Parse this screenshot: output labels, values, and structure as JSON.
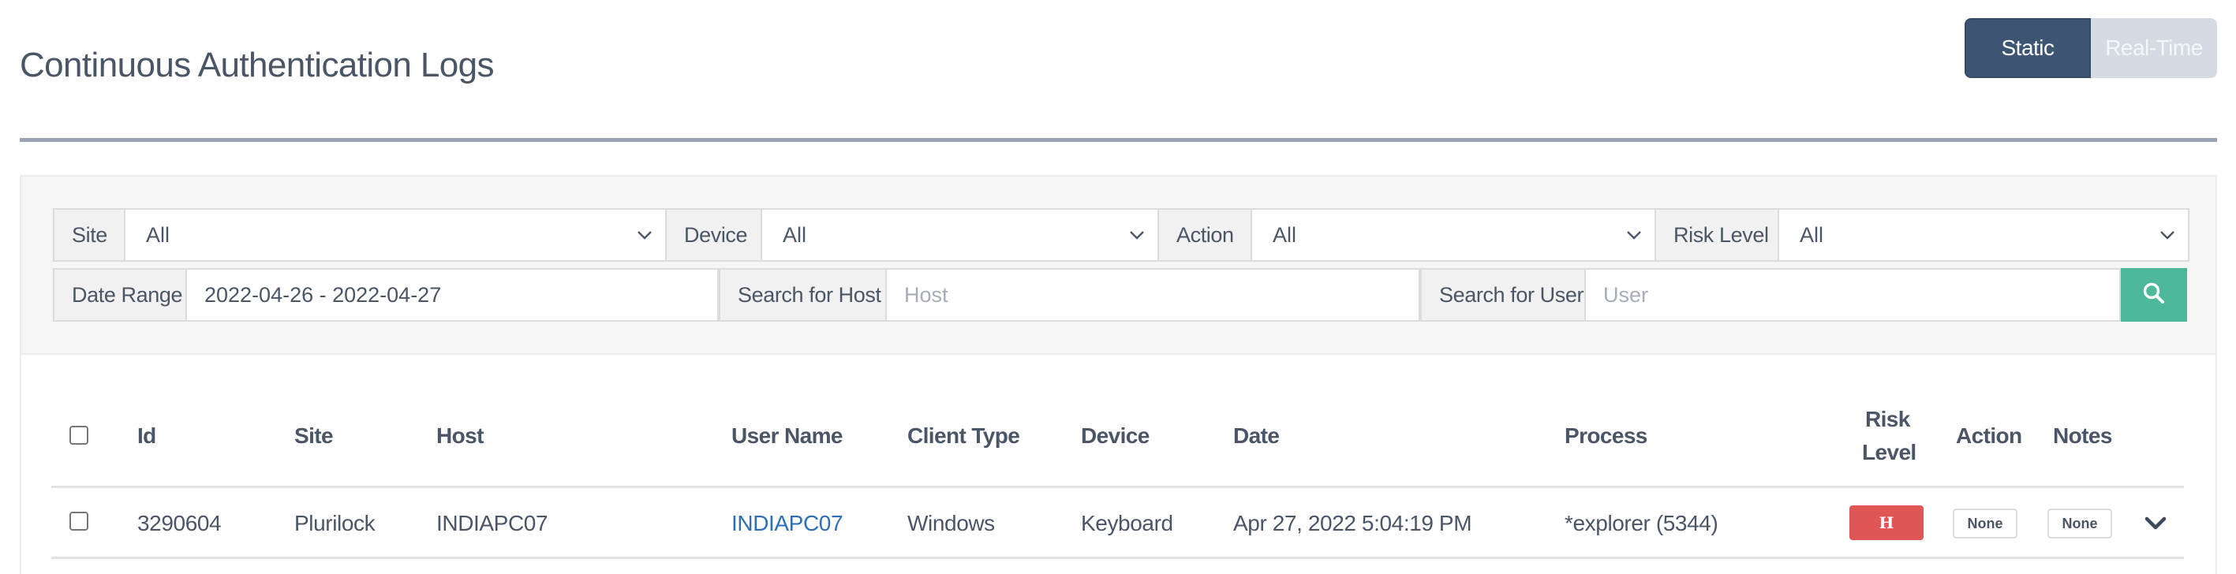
{
  "page": {
    "title": "Continuous Authentication Logs",
    "view_toggle": {
      "static_label": "Static",
      "realtime_label": "Real-Time",
      "active": "Static"
    }
  },
  "filters": {
    "site": {
      "label": "Site",
      "value": "All"
    },
    "device": {
      "label": "Device",
      "value": "All"
    },
    "action": {
      "label": "Action",
      "value": "All"
    },
    "risk_level": {
      "label": "Risk Level",
      "value": "All"
    },
    "date_range": {
      "label": "Date Range",
      "value": "2022-04-26 - 2022-04-27"
    },
    "host_search": {
      "label": "Search for Host",
      "placeholder": "Host"
    },
    "user_search": {
      "label": "Search for User",
      "placeholder": "User"
    }
  },
  "table": {
    "columns": {
      "id": "Id",
      "site": "Site",
      "host": "Host",
      "user_name": "User Name",
      "client_type": "Client Type",
      "device": "Device",
      "date": "Date",
      "process": "Process",
      "risk_level_1": "Risk",
      "risk_level_2": "Level",
      "action": "Action",
      "notes": "Notes"
    },
    "rows": [
      {
        "id": "3290604",
        "site": "Plurilock",
        "host": "INDIAPC07",
        "user_name": "INDIAPC07",
        "client_type": "Windows",
        "device": "Keyboard",
        "date": "Apr 27, 2022 5:04:19 PM",
        "process": "*explorer (5344)",
        "risk_level": "H",
        "action": "None",
        "notes": "None"
      }
    ]
  },
  "colors": {
    "accent_dark": "#3d5573",
    "search_button": "#4db89a",
    "risk_high": "#e05555",
    "link": "#2f6fb5"
  },
  "icons": {
    "search": "search-icon",
    "dropdown": "chevron-down-icon",
    "expand": "chevron-down-icon"
  }
}
